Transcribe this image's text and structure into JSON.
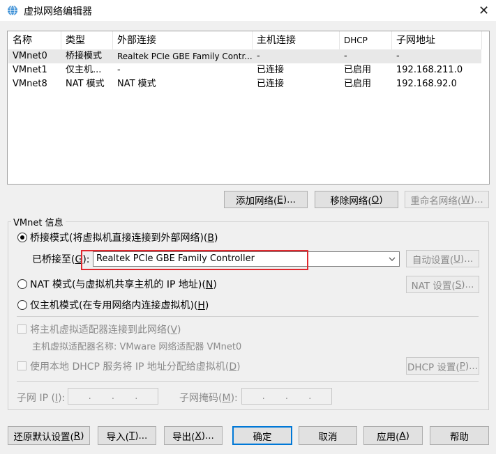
{
  "window": {
    "title": "虚拟网络编辑器",
    "close_glyph": "✕"
  },
  "table": {
    "columns": [
      "名称",
      "类型",
      "外部连接",
      "主机连接",
      "DHCP",
      "子网地址"
    ],
    "rows": [
      [
        "VMnet0",
        "桥接模式",
        "Realtek PCIe GBE Family Contr...",
        "-",
        "-",
        "-"
      ],
      [
        "VMnet1",
        "仅主机...",
        "-",
        "已连接",
        "已启用",
        "192.168.211.0"
      ],
      [
        "VMnet8",
        "NAT 模式",
        "NAT 模式",
        "已连接",
        "已启用",
        "192.168.92.0"
      ]
    ],
    "selected_row": 0
  },
  "list_buttons": {
    "add": {
      "pre": "添加网络(",
      "key": "E",
      "post": ")..."
    },
    "remove": {
      "pre": "移除网络(",
      "key": "O",
      "post": ")"
    },
    "rename": {
      "pre": "重命名网络(",
      "key": "W",
      "post": ")..."
    }
  },
  "vmnet_info": {
    "legend": "VMnet 信息",
    "bridged": {
      "pre": "桥接模式(将虚拟机直接连接到外部网络)(",
      "key": "B",
      "post": ")",
      "checked": true
    },
    "bridged_to": {
      "pre": "已桥接至(",
      "key": "G",
      "post": "):"
    },
    "bridged_adapter": "Realtek PCIe GBE Family Controller",
    "auto_settings": {
      "pre": "自动设置(",
      "key": "U",
      "post": ")..."
    },
    "nat": {
      "pre": "NAT 模式(与虚拟机共享主机的 IP 地址)(",
      "key": "N",
      "post": ")",
      "checked": false
    },
    "nat_settings": {
      "pre": "NAT 设置(",
      "key": "S",
      "post": ")..."
    },
    "host_only": {
      "pre": "仅主机模式(在专用网络内连接虚拟机)(",
      "key": "H",
      "post": ")",
      "checked": false
    },
    "connect_host_adapter": {
      "pre": "将主机虚拟适配器连接到此网络(",
      "key": "V",
      "post": ")",
      "checked": false
    },
    "host_adapter_name": "主机虚拟适配器名称: VMware 网络适配器 VMnet0",
    "use_dhcp": {
      "pre": "使用本地 DHCP 服务将 IP 地址分配给虚拟机(",
      "key": "D",
      "post": ")",
      "checked": false
    },
    "dhcp_settings": {
      "pre": "DHCP 设置(",
      "key": "P",
      "post": ")..."
    },
    "subnet_ip": {
      "pre": "子网 IP (",
      "key": "I",
      "post": "):"
    },
    "subnet_mask": {
      "pre": "子网掩码(",
      "key": "M",
      "post": "):"
    },
    "ip_dots": ".",
    "mask_dots": "."
  },
  "footer_buttons": {
    "restore": {
      "pre": "还原默认设置(",
      "key": "R",
      "post": ")"
    },
    "import": {
      "pre": "导入(",
      "key": "T",
      "post": ")..."
    },
    "export": {
      "pre": "导出(",
      "key": "X",
      "post": ")..."
    },
    "ok": "确定",
    "cancel": "取消",
    "apply": {
      "pre": "应用(",
      "key": "A",
      "post": ")"
    },
    "help": "帮助"
  },
  "colors": {
    "highlight_box": "#e0282e",
    "default_button_border": "#0078d7"
  }
}
